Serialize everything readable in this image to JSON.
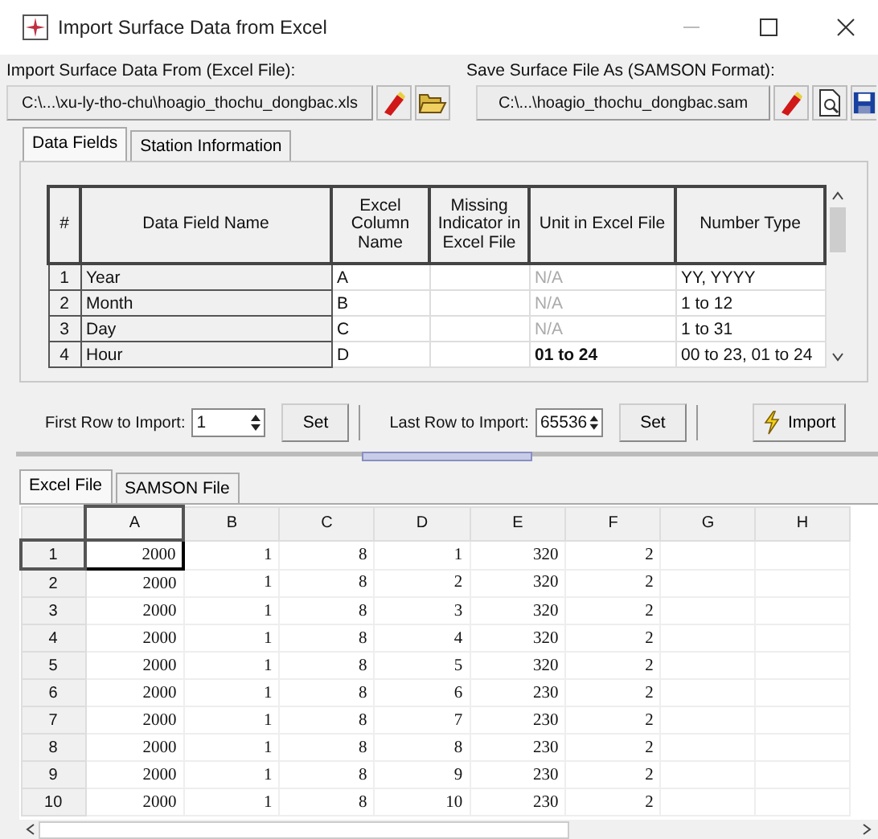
{
  "window": {
    "title": "Import Surface Data from Excel"
  },
  "import_from": {
    "label": "Import Surface Data From (Excel File):",
    "value": "C:\\...\\xu-ly-tho-chu\\hoagio_thochu_dongbac.xls"
  },
  "save_as": {
    "label": "Save Surface File As (SAMSON Format):",
    "value": "C:\\...\\hoagio_thochu_dongbac.sam"
  },
  "tabs": [
    {
      "label": "Data Fields",
      "selected": true
    },
    {
      "label": "Station Information",
      "selected": false
    }
  ],
  "fields_table": {
    "columns": [
      "#",
      "Data Field Name",
      "Excel Column Name",
      "Missing Indicator in Excel File",
      "Unit in Excel File",
      "Number Type"
    ],
    "rows": [
      {
        "number": "1",
        "name": "Year",
        "column": "A",
        "unit": "N/A",
        "unit_disabled": true,
        "number_type": "YY, YYYY"
      },
      {
        "number": "2",
        "name": "Month",
        "column": "B",
        "unit": "N/A",
        "unit_disabled": true,
        "number_type": "1 to 12"
      },
      {
        "number": "3",
        "name": "Day",
        "column": "C",
        "unit": "N/A",
        "unit_disabled": true,
        "number_type": "1 to 31"
      },
      {
        "number": "4",
        "name": "Hour",
        "column": "D",
        "unit": "01 to 24",
        "unit_disabled": false,
        "number_type": "00 to 23, 01 to 24"
      }
    ]
  },
  "first_row": {
    "label": "First Row to Import:",
    "value": "1",
    "button": "Set"
  },
  "last_row": {
    "label": "Last Row to Import:",
    "value": "65536",
    "button": "Set"
  },
  "import_button": "Import",
  "sheet_tabs": [
    {
      "label": "Excel File",
      "selected": true
    },
    {
      "label": "SAMSON File",
      "selected": false
    }
  ],
  "sheet": {
    "columns": [
      {
        "label": "A",
        "selected": true
      },
      {
        "label": "B",
        "selected": false
      },
      {
        "label": "C",
        "selected": false
      },
      {
        "label": "D",
        "selected": false
      },
      {
        "label": "E",
        "selected": false
      },
      {
        "label": "F",
        "selected": false
      },
      {
        "label": "G",
        "selected": false
      },
      {
        "label": "H",
        "selected": false
      }
    ],
    "rows": [
      {
        "label": "1",
        "selected": true,
        "cells": [
          "2000",
          "1",
          "8",
          "1",
          "320",
          "2"
        ]
      },
      {
        "label": "2",
        "selected": false,
        "cells": [
          "2000",
          "1",
          "8",
          "2",
          "320",
          "2"
        ]
      },
      {
        "label": "3",
        "selected": false,
        "cells": [
          "2000",
          "1",
          "8",
          "3",
          "320",
          "2"
        ]
      },
      {
        "label": "4",
        "selected": false,
        "cells": [
          "2000",
          "1",
          "8",
          "4",
          "320",
          "2"
        ]
      },
      {
        "label": "5",
        "selected": false,
        "cells": [
          "2000",
          "1",
          "8",
          "5",
          "320",
          "2"
        ]
      },
      {
        "label": "6",
        "selected": false,
        "cells": [
          "2000",
          "1",
          "8",
          "6",
          "230",
          "2"
        ]
      },
      {
        "label": "7",
        "selected": false,
        "cells": [
          "2000",
          "1",
          "8",
          "7",
          "230",
          "2"
        ]
      },
      {
        "label": "8",
        "selected": false,
        "cells": [
          "2000",
          "1",
          "8",
          "8",
          "230",
          "2"
        ]
      },
      {
        "label": "9",
        "selected": false,
        "cells": [
          "2000",
          "1",
          "8",
          "9",
          "230",
          "2"
        ]
      },
      {
        "label": "10",
        "selected": false,
        "cells": [
          "2000",
          "1",
          "8",
          "10",
          "230",
          "2"
        ]
      }
    ]
  }
}
